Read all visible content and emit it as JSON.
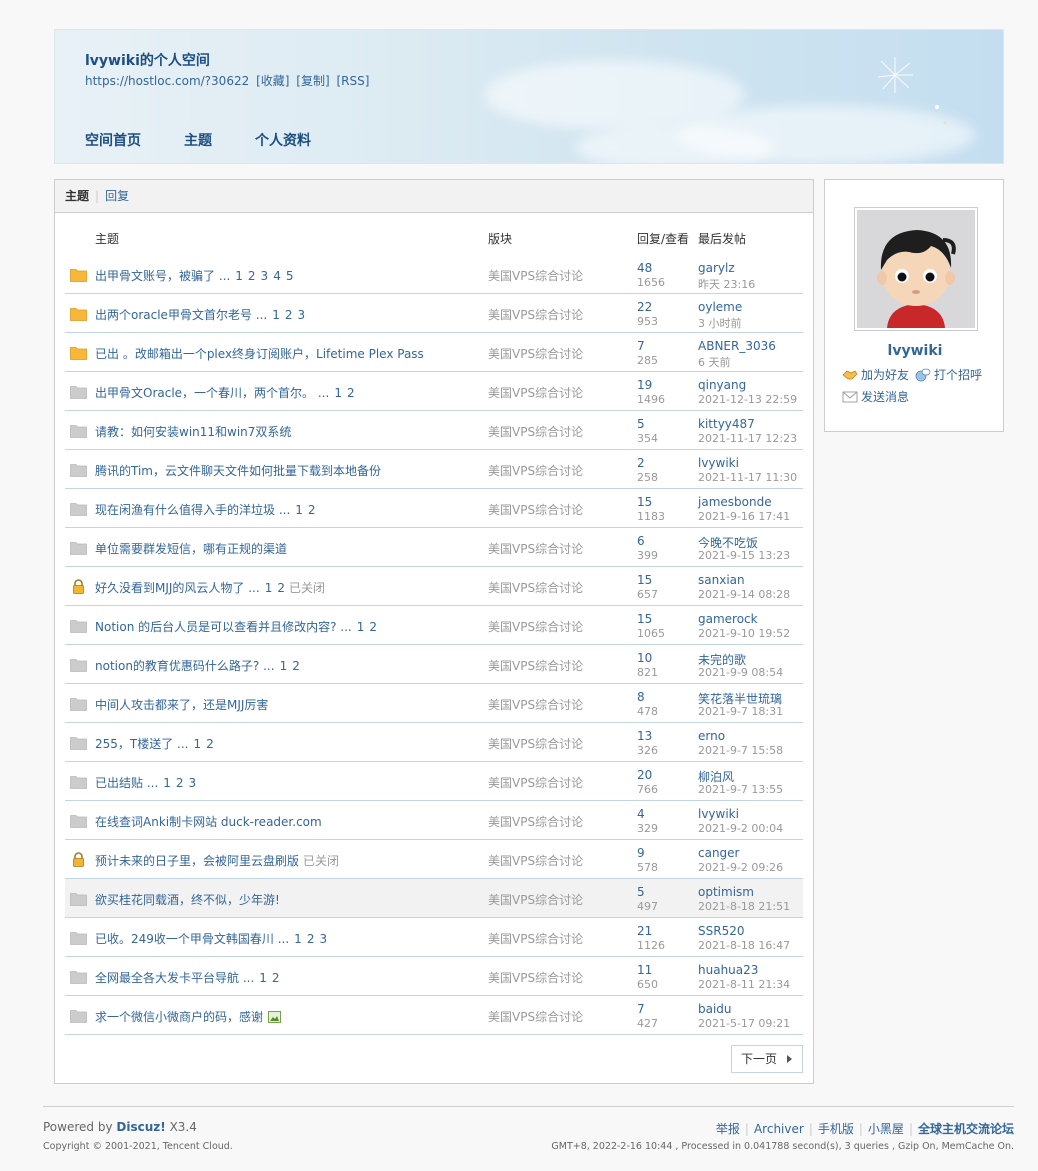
{
  "header": {
    "title": "lvywiki的个人空间",
    "url": "https://hostloc.com/?30622",
    "url_actions": [
      "[收藏]",
      "[复制]",
      "[RSS]"
    ],
    "nav": [
      "空间首页",
      "主题",
      "个人资料"
    ]
  },
  "tabs": {
    "active": "主题",
    "other": "回复"
  },
  "table_headers": {
    "subject": "主题",
    "forum": "版块",
    "replies_views": "回复/查看",
    "last_post": "最后发帖"
  },
  "threads": [
    {
      "icon": "folder-new",
      "title": "出甲骨文账号，被骗了 ...",
      "pages": [
        "1",
        "2",
        "3",
        "4",
        "5"
      ],
      "closed": "",
      "forum": "美国VPS综合讨论",
      "replies": "48",
      "views": "1656",
      "last_user": "garylz",
      "last_time": "昨天 23:16"
    },
    {
      "icon": "folder-new",
      "title": "出两个oracle甲骨文首尔老号 ...",
      "pages": [
        "1",
        "2",
        "3"
      ],
      "closed": "",
      "forum": "美国VPS综合讨论",
      "replies": "22",
      "views": "953",
      "last_user": "oyleme",
      "last_time": "3 小时前"
    },
    {
      "icon": "folder-new",
      "title": "已出 。改邮箱出一个plex终身订阅账户，Lifetime Plex Pass",
      "pages": [],
      "closed": "",
      "forum": "美国VPS综合讨论",
      "replies": "7",
      "views": "285",
      "last_user": "ABNER_3036",
      "last_time": "6 天前"
    },
    {
      "icon": "folder",
      "title": "出甲骨文Oracle，一个春川，两个首尔。 ...",
      "pages": [
        "1",
        "2"
      ],
      "closed": "",
      "forum": "美国VPS综合讨论",
      "replies": "19",
      "views": "1496",
      "last_user": "qinyang",
      "last_time": "2021-12-13 22:59"
    },
    {
      "icon": "folder",
      "title": "请教：如何安装win11和win7双系统",
      "pages": [],
      "closed": "",
      "forum": "美国VPS综合讨论",
      "replies": "5",
      "views": "354",
      "last_user": "kittyy487",
      "last_time": "2021-11-17 12:23"
    },
    {
      "icon": "folder",
      "title": "腾讯的Tim，云文件聊天文件如何批量下载到本地备份",
      "pages": [],
      "closed": "",
      "forum": "美国VPS综合讨论",
      "replies": "2",
      "views": "258",
      "last_user": "lvywiki",
      "last_time": "2021-11-17 11:30"
    },
    {
      "icon": "folder",
      "title": "现在闲渔有什么值得入手的洋垃圾 ...",
      "pages": [
        "1",
        "2"
      ],
      "closed": "",
      "forum": "美国VPS综合讨论",
      "replies": "15",
      "views": "1183",
      "last_user": "jamesbonde",
      "last_time": "2021-9-16 17:41"
    },
    {
      "icon": "folder",
      "title": "单位需要群发短信，哪有正规的渠道",
      "pages": [],
      "closed": "",
      "forum": "美国VPS综合讨论",
      "replies": "6",
      "views": "399",
      "last_user": "今晚不吃饭",
      "last_time": "2021-9-15 13:23"
    },
    {
      "icon": "lock",
      "title": "好久没看到MJJ的风云人物了 ...",
      "pages": [
        "1",
        "2"
      ],
      "closed": "已关闭",
      "forum": "美国VPS综合讨论",
      "replies": "15",
      "views": "657",
      "last_user": "sanxian",
      "last_time": "2021-9-14 08:28"
    },
    {
      "icon": "folder",
      "title": "Notion 的后台人员是可以查看并且修改内容? ...",
      "pages": [
        "1",
        "2"
      ],
      "closed": "",
      "forum": "美国VPS综合讨论",
      "replies": "15",
      "views": "1065",
      "last_user": "gamerock",
      "last_time": "2021-9-10 19:52"
    },
    {
      "icon": "folder",
      "title": "notion的教育优惠码什么路子? ...",
      "pages": [
        "1",
        "2"
      ],
      "closed": "",
      "forum": "美国VPS综合讨论",
      "replies": "10",
      "views": "821",
      "last_user": "未完的歌",
      "last_time": "2021-9-9 08:54"
    },
    {
      "icon": "folder",
      "title": "中间人攻击都来了，还是MJJ厉害",
      "pages": [],
      "closed": "",
      "forum": "美国VPS综合讨论",
      "replies": "8",
      "views": "478",
      "last_user": "笑花落半世琉璃",
      "last_time": "2021-9-7 18:31"
    },
    {
      "icon": "folder",
      "title": "255，T楼送了 ...",
      "pages": [
        "1",
        "2"
      ],
      "closed": "",
      "forum": "美国VPS综合讨论",
      "replies": "13",
      "views": "326",
      "last_user": "erno",
      "last_time": "2021-9-7 15:58"
    },
    {
      "icon": "folder",
      "title": "已出结贴 ...",
      "pages": [
        "1",
        "2",
        "3"
      ],
      "closed": "",
      "forum": "美国VPS综合讨论",
      "replies": "20",
      "views": "766",
      "last_user": "柳泊风",
      "last_time": "2021-9-7 13:55"
    },
    {
      "icon": "folder",
      "title": "在线查词Anki制卡网站 duck-reader.com",
      "pages": [],
      "closed": "",
      "forum": "美国VPS综合讨论",
      "replies": "4",
      "views": "329",
      "last_user": "lvywiki",
      "last_time": "2021-9-2 00:04"
    },
    {
      "icon": "lock",
      "title": "预计未来的日子里，会被阿里云盘刷版",
      "pages": [],
      "closed": "已关闭",
      "forum": "美国VPS综合讨论",
      "replies": "9",
      "views": "578",
      "last_user": "canger",
      "last_time": "2021-9-2 09:26"
    },
    {
      "icon": "folder",
      "title": "欲买桂花同载酒，终不似，少年游!",
      "pages": [],
      "closed": "",
      "forum": "美国VPS综合讨论",
      "replies": "5",
      "views": "497",
      "last_user": "optimism",
      "last_time": "2021-8-18 21:51",
      "highlight": true
    },
    {
      "icon": "folder",
      "title": "已收。249收一个甲骨文韩国春川 ...",
      "pages": [
        "1",
        "2",
        "3"
      ],
      "closed": "",
      "forum": "美国VPS综合讨论",
      "replies": "21",
      "views": "1126",
      "last_user": "SSR520",
      "last_time": "2021-8-18 16:47"
    },
    {
      "icon": "folder",
      "title": "全网最全各大发卡平台导航 ...",
      "pages": [
        "1",
        "2"
      ],
      "closed": "",
      "forum": "美国VPS综合讨论",
      "replies": "11",
      "views": "650",
      "last_user": "huahua23",
      "last_time": "2021-8-11 21:34"
    },
    {
      "icon": "folder",
      "title": "求一个微信小微商户的码，感谢",
      "pages": [],
      "closed": "",
      "attachment": "image-icon",
      "forum": "美国VPS综合讨论",
      "replies": "7",
      "views": "427",
      "last_user": "baidu",
      "last_time": "2021-5-17 09:21"
    }
  ],
  "next_page": "下一页",
  "sidebar": {
    "username": "lvywiki",
    "actions": {
      "add_friend": "加为好友",
      "greet": "打个招呼",
      "message": "发送消息"
    }
  },
  "footer": {
    "powered_prefix": "Powered by",
    "product": "Discuz!",
    "version": "X3.4",
    "copyright": "Copyright © 2001-2021, Tencent Cloud.",
    "links": [
      "举报",
      "Archiver",
      "手机版",
      "小黑屋",
      "全球主机交流论坛"
    ],
    "debug": "GMT+8, 2022-2-16 10:44 , Processed in 0.041788 second(s), 3 queries , Gzip On, MemCache On."
  },
  "colors": {
    "link": "#336699",
    "header_bg": "#dbeaf2",
    "folder_new": "#f9b73a",
    "folder": "#cccccc"
  }
}
